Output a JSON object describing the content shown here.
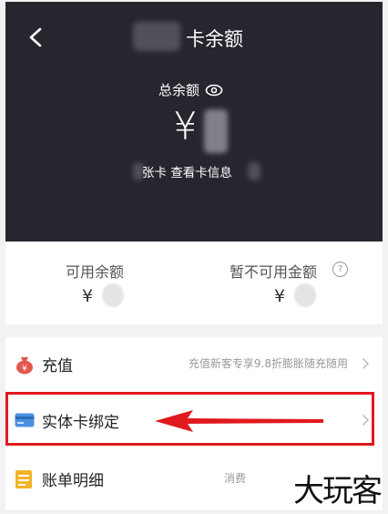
{
  "header": {
    "title_suffix": "卡余额",
    "total_label": "总余额",
    "currency": "¥",
    "card_info": "张卡 查看卡信息"
  },
  "balances": {
    "available_label": "可用余额",
    "available_currency": "¥",
    "unavailable_label": "暂不可用金额",
    "unavailable_currency": "¥",
    "help_glyph": "?"
  },
  "list": {
    "items": [
      {
        "label": "充值",
        "detail": "充值新客专享9.8折膨胀随充随用"
      },
      {
        "label": "实体卡绑定",
        "detail": ""
      },
      {
        "label": "账单明细",
        "detail": "消费"
      }
    ]
  },
  "watermark": "大玩客",
  "colors": {
    "header_bg": "#26262e",
    "annotation_red": "#e0191f"
  }
}
